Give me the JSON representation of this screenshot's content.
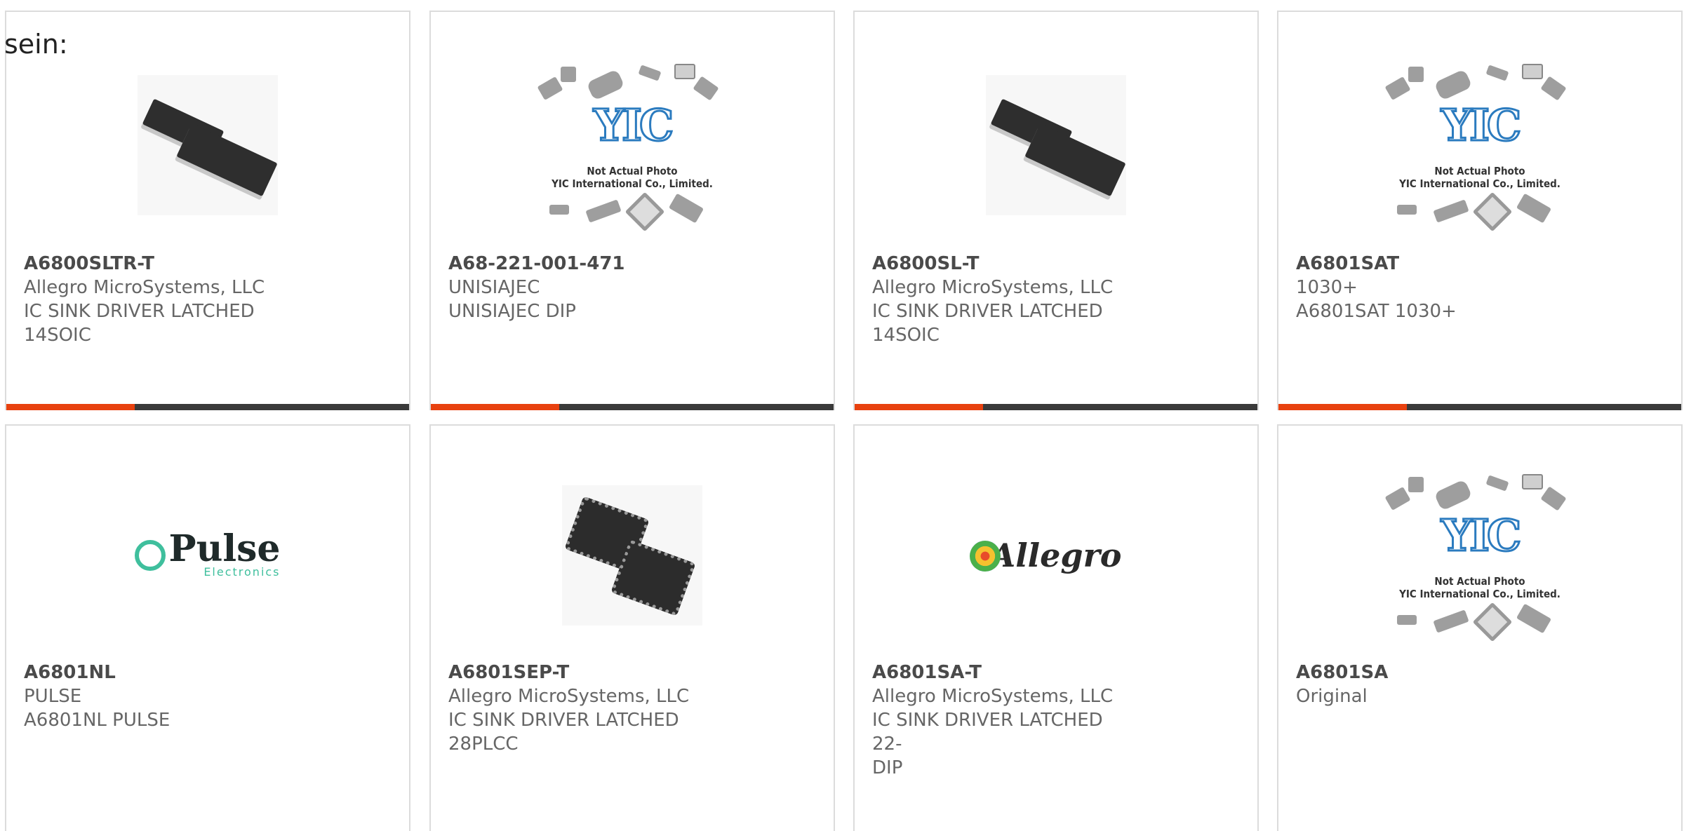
{
  "intro_text": "sein:",
  "colors": {
    "accent": "#e8410f",
    "bar": "#3a3a3a",
    "border": "#dcdcdc"
  },
  "products": [
    {
      "part_number": "A6800SLTR-T",
      "lines": [
        "Allegro MicroSystems, LLC",
        "IC SINK DRIVER LATCHED",
        "14SOIC"
      ],
      "image": "soic-chip-image"
    },
    {
      "part_number": "A68-221-001-471",
      "lines": [
        "UNISIAJEC",
        "UNISIAJEC DIP"
      ],
      "image": "yic-placeholder-image",
      "image_caption_1": "Not Actual Photo",
      "image_caption_2": "YIC International Co., Limited."
    },
    {
      "part_number": "A6800SL-T",
      "lines": [
        "Allegro MicroSystems, LLC",
        "IC SINK DRIVER LATCHED",
        "14SOIC"
      ],
      "image": "soic-chip-image"
    },
    {
      "part_number": "A6801SAT",
      "lines": [
        "1030+",
        "A6801SAT 1030+"
      ],
      "image": "yic-placeholder-image",
      "image_caption_1": "Not Actual Photo",
      "image_caption_2": "YIC International Co., Limited."
    },
    {
      "part_number": "A6801NL",
      "lines": [
        "PULSE",
        "A6801NL PULSE"
      ],
      "image": "pulse-logo-image",
      "logo_word": "Pulse",
      "logo_sub": "Electronics"
    },
    {
      "part_number": "A6801SEP-T",
      "lines": [
        "Allegro MicroSystems, LLC",
        "IC SINK DRIVER LATCHED",
        "28PLCC"
      ],
      "image": "plcc-chip-image"
    },
    {
      "part_number": "A6801SA-T",
      "lines": [
        "Allegro MicroSystems, LLC",
        "IC SINK DRIVER LATCHED 22-",
        "DIP"
      ],
      "image": "allegro-logo-image",
      "logo_word": "Allegro"
    },
    {
      "part_number": "A6801SA",
      "lines": [
        "Original"
      ],
      "image": "yic-placeholder-image",
      "image_caption_1": "Not Actual Photo",
      "image_caption_2": "YIC International Co., Limited."
    }
  ]
}
